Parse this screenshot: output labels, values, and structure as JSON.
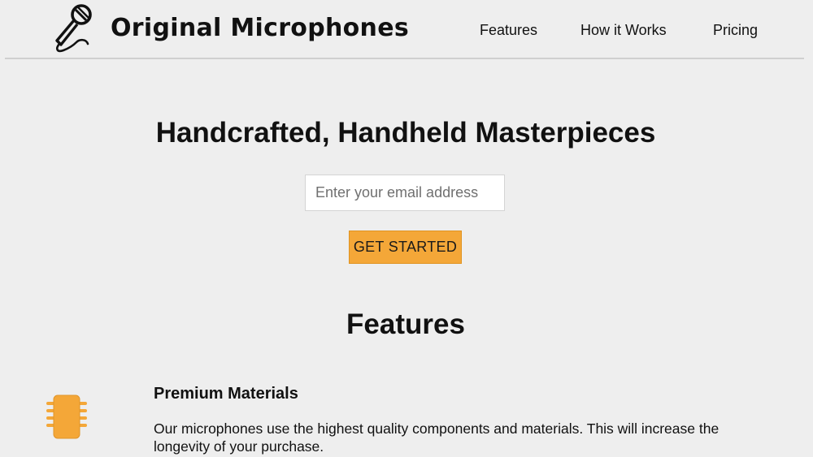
{
  "header": {
    "brand": "Original Microphones",
    "logo_icon": "microphone-icon",
    "nav": [
      {
        "label": "Features"
      },
      {
        "label": "How it Works"
      },
      {
        "label": "Pricing"
      }
    ]
  },
  "hero": {
    "title": "Handcrafted, Handheld Masterpieces",
    "email_placeholder": "Enter your email address",
    "cta_label": "GET STARTED"
  },
  "features": {
    "title": "Features",
    "items": [
      {
        "icon": "chip-icon",
        "heading": "Premium Materials",
        "description": "Our microphones use the highest quality components and materials. This will increase the longevity of your purchase."
      }
    ]
  },
  "colors": {
    "background": "#eeeeee",
    "accent": "#f4a738",
    "text": "#111111"
  }
}
